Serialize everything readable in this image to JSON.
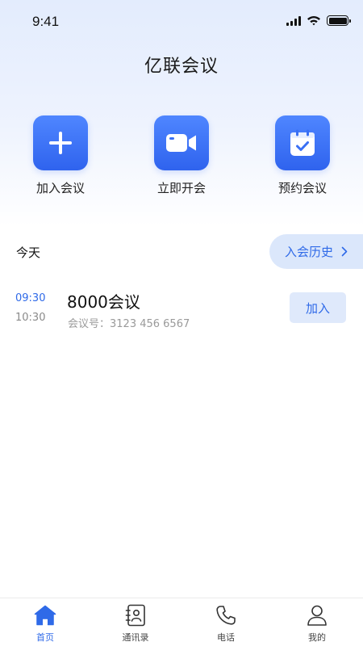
{
  "status_bar": {
    "time": "9:41",
    "icons": [
      "signal-icon",
      "wifi-icon",
      "battery-icon"
    ]
  },
  "header": {
    "title": "亿联会议"
  },
  "actions": [
    {
      "label": "加入会议",
      "icon": "plus-icon"
    },
    {
      "label": "立即开会",
      "icon": "video-camera-icon"
    },
    {
      "label": "预约会议",
      "icon": "calendar-check-icon"
    }
  ],
  "meetings_section": {
    "title": "今天",
    "history_label": "入会历史",
    "items": [
      {
        "start": "09:30",
        "end": "10:30",
        "name": "8000会议",
        "meeting_id": "会议号：3123 456 6567",
        "join_label": "加入"
      }
    ]
  },
  "tabbar": {
    "items": [
      {
        "label": "首页",
        "icon": "home-icon",
        "active": true
      },
      {
        "label": "通讯录",
        "icon": "contacts-icon",
        "active": false
      },
      {
        "label": "电话",
        "icon": "phone-icon",
        "active": false
      },
      {
        "label": "我的",
        "icon": "user-icon",
        "active": false
      }
    ]
  },
  "colors": {
    "accent": "#2f6ae8",
    "tile_top": "#4f86ff",
    "tile_bottom": "#2f63ee",
    "chip_bg": "#dbe7fb"
  }
}
